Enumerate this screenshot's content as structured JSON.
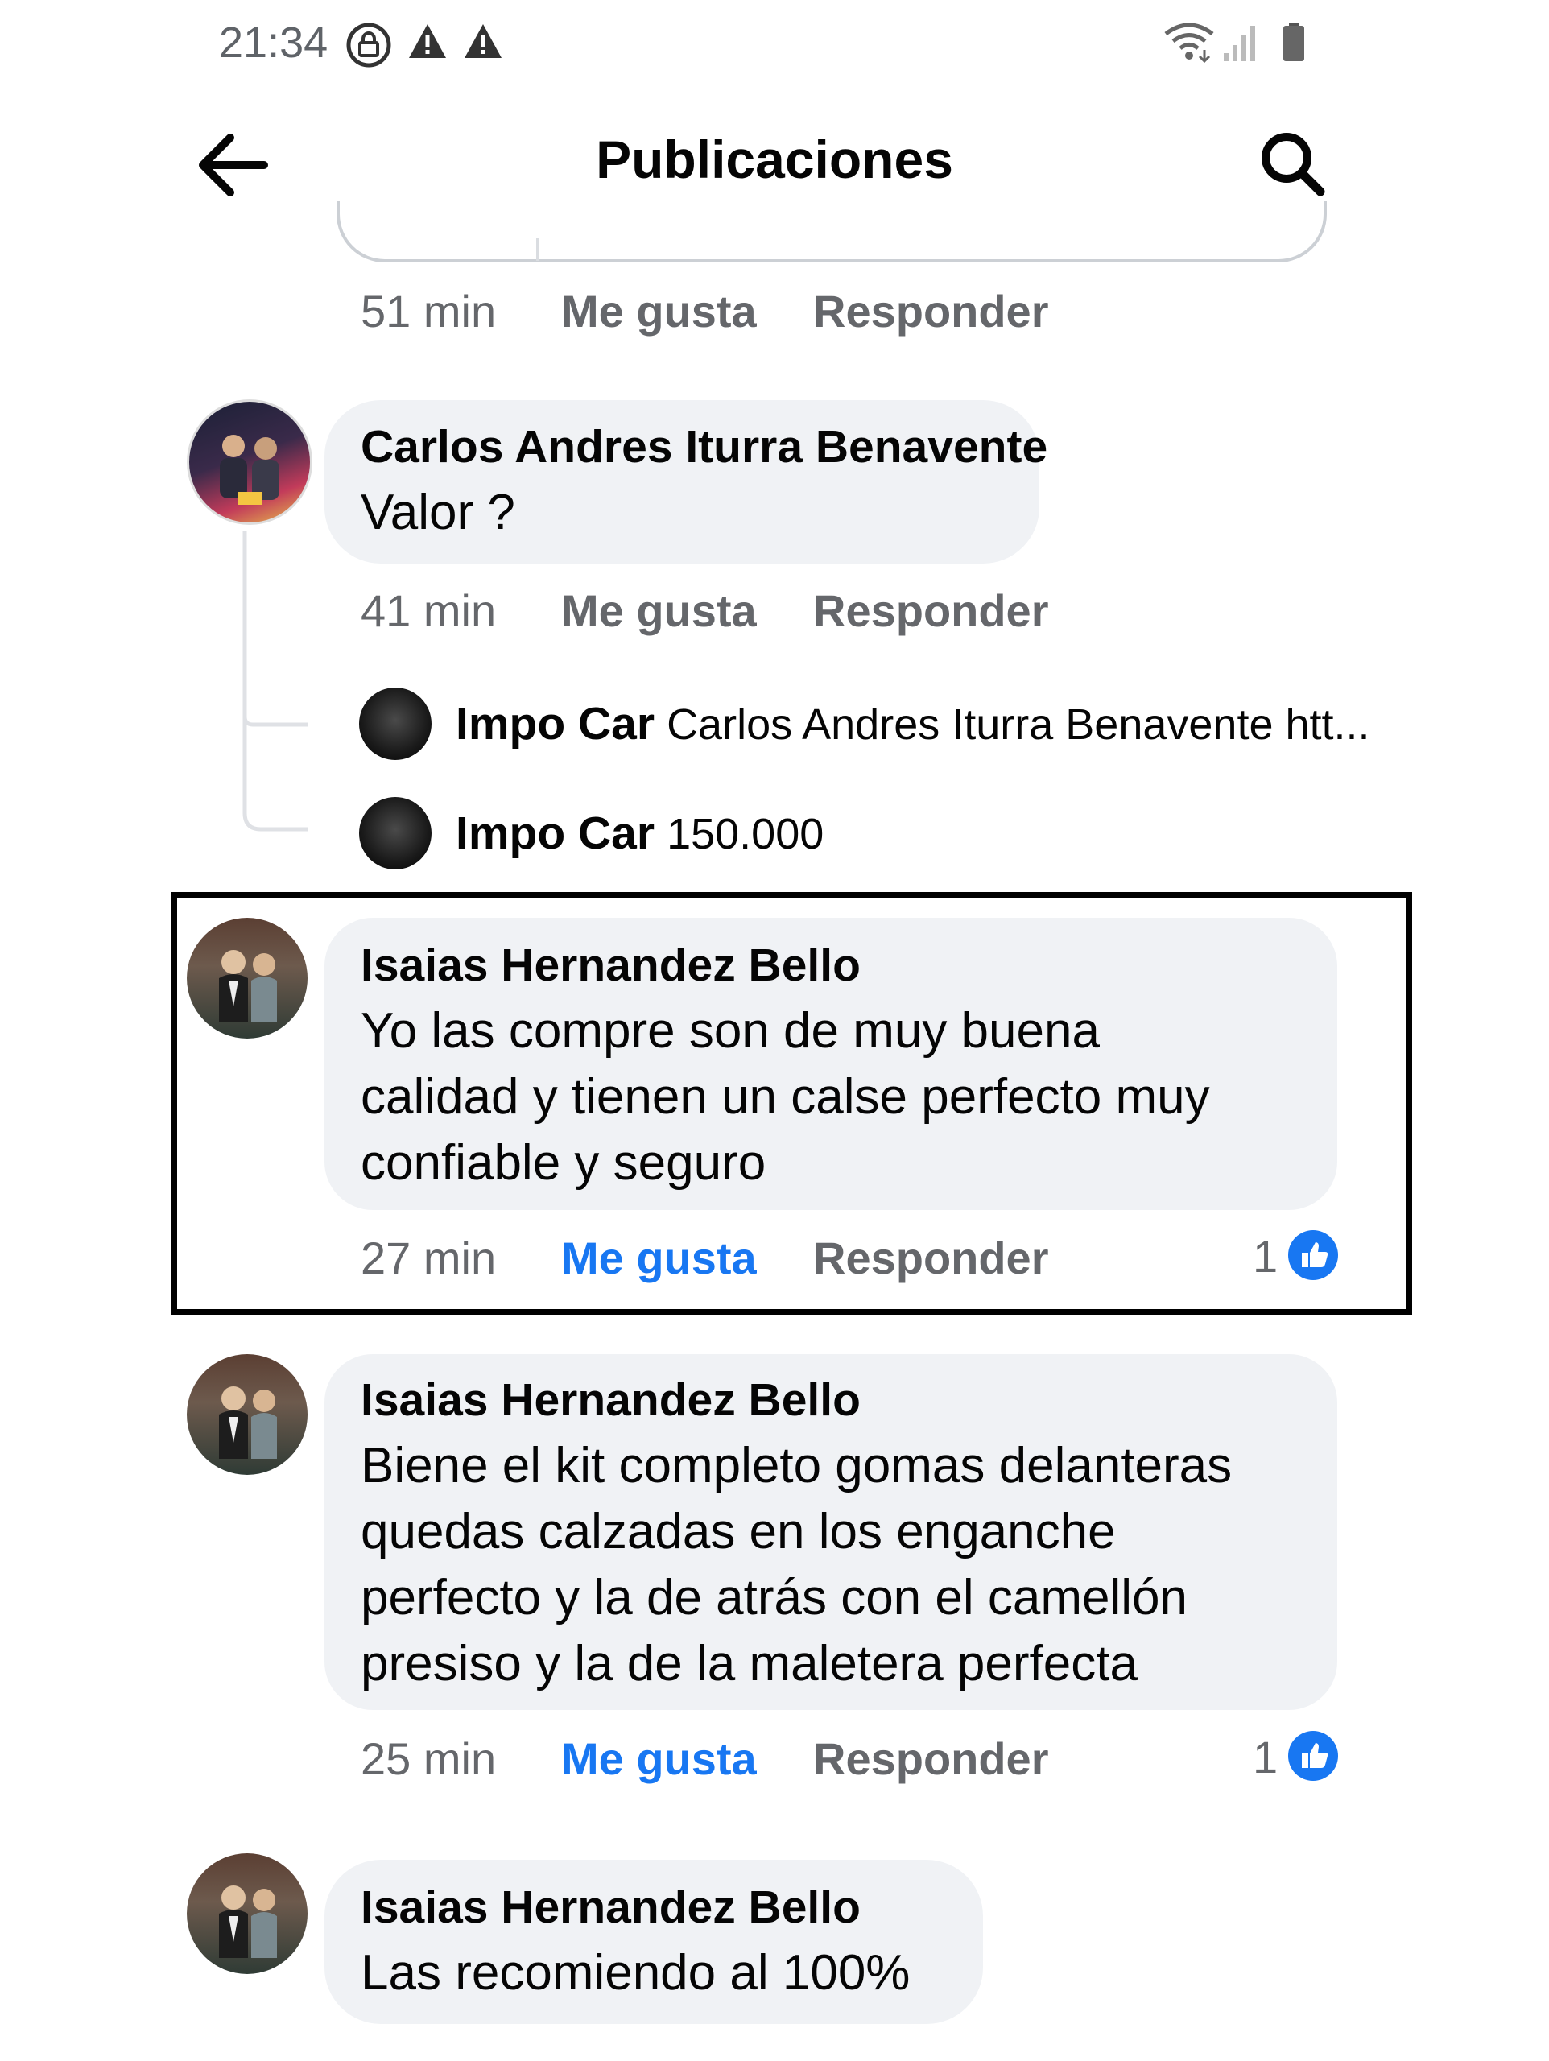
{
  "status_bar": {
    "time": "21:34",
    "icons": [
      "lock-icon",
      "warning-icon",
      "warning-icon",
      "wifi-icon",
      "signal-icon",
      "battery-icon"
    ]
  },
  "header": {
    "title": "Publicaciones",
    "back_icon": "arrow-left-icon",
    "search_icon": "search-icon"
  },
  "colors": {
    "bubble": "#f0f2f5",
    "meta_gray": "#65676b",
    "like_blue": "#1877f2"
  },
  "actions": {
    "like": "Me gusta",
    "reply": "Responder"
  },
  "top_comment": {
    "time": "51 min"
  },
  "comments": [
    {
      "author": "Carlos Andres Iturra Benavente",
      "lines": [
        "Valor ?"
      ],
      "time": "41 min",
      "replies": [
        {
          "author": "Impo Car",
          "text": "Carlos Andres Iturra Benavente htt..."
        },
        {
          "author": "Impo Car",
          "text": "150.000"
        }
      ]
    },
    {
      "author": "Isaias Hernandez Bello",
      "lines": [
        "Yo las compre son de muy buena",
        "calidad y tienen un calse perfecto muy",
        "confiable y seguro"
      ],
      "time": "27 min",
      "likes": "1",
      "liked": true
    },
    {
      "author": "Isaias Hernandez Bello",
      "lines": [
        "Biene el kit completo gomas delanteras",
        "quedas calzadas en los enganche",
        "perfecto y la de atrás con el camellón",
        "presiso y la de la  maletera  perfecta"
      ],
      "time": "25 min",
      "likes": "1",
      "liked": true
    },
    {
      "author": "Isaias Hernandez Bello",
      "lines": [
        "Las recomiendo al 100%"
      ]
    }
  ]
}
